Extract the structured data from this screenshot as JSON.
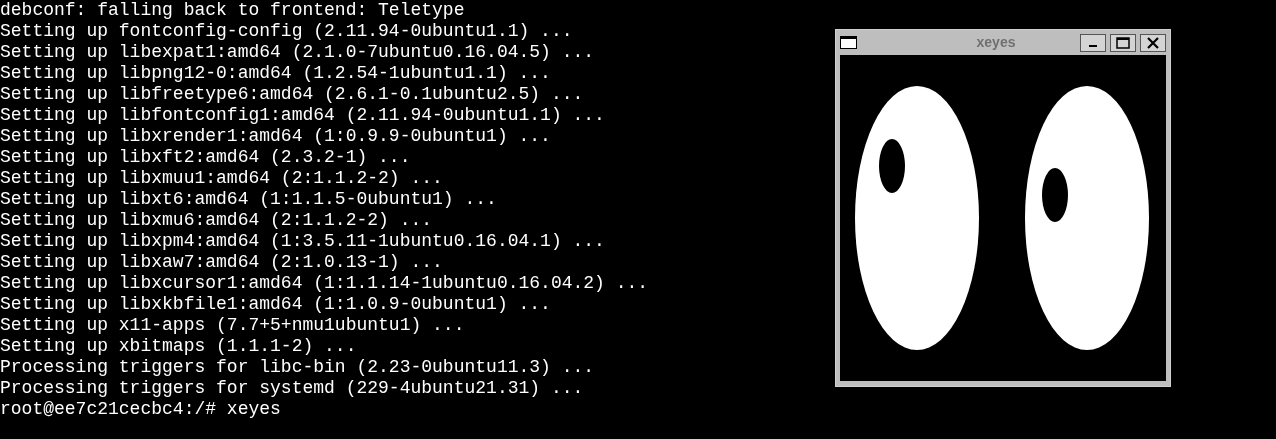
{
  "terminal": {
    "lines": [
      "debconf: falling back to frontend: Teletype",
      "Setting up fontconfig-config (2.11.94-0ubuntu1.1) ...",
      "Setting up libexpat1:amd64 (2.1.0-7ubuntu0.16.04.5) ...",
      "Setting up libpng12-0:amd64 (1.2.54-1ubuntu1.1) ...",
      "Setting up libfreetype6:amd64 (2.6.1-0.1ubuntu2.5) ...",
      "Setting up libfontconfig1:amd64 (2.11.94-0ubuntu1.1) ...",
      "Setting up libxrender1:amd64 (1:0.9.9-0ubuntu1) ...",
      "Setting up libxft2:amd64 (2.3.2-1) ...",
      "Setting up libxmuu1:amd64 (2:1.1.2-2) ...",
      "Setting up libxt6:amd64 (1:1.1.5-0ubuntu1) ...",
      "Setting up libxmu6:amd64 (2:1.1.2-2) ...",
      "Setting up libxpm4:amd64 (1:3.5.11-1ubuntu0.16.04.1) ...",
      "Setting up libxaw7:amd64 (2:1.0.13-1) ...",
      "Setting up libxcursor1:amd64 (1:1.1.14-1ubuntu0.16.04.2) ...",
      "Setting up libxkbfile1:amd64 (1:1.0.9-0ubuntu1) ...",
      "Setting up x11-apps (7.7+5+nmu1ubuntu1) ...",
      "Setting up xbitmaps (1.1.1-2) ...",
      "Processing triggers for libc-bin (2.23-0ubuntu11.3) ...",
      "Processing triggers for systemd (229-4ubuntu21.31) ...",
      "root@ee7c21cecbc4:/# xeyes"
    ]
  },
  "window": {
    "title": "xeyes"
  }
}
